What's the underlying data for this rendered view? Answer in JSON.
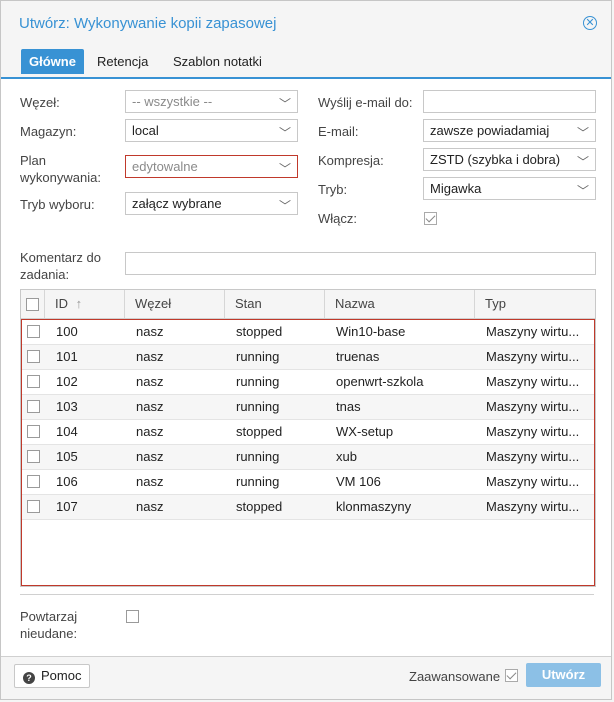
{
  "window": {
    "title": "Utwórz: Wykonywanie kopii zapasowej",
    "close_icon": "close-circle-icon"
  },
  "tabs": [
    {
      "label": "Główne",
      "active": true
    },
    {
      "label": "Retencja",
      "active": false
    },
    {
      "label": "Szablon notatki",
      "active": false
    }
  ],
  "form_left": {
    "node": {
      "label": "Węzeł:",
      "value": "-- wszystkie --"
    },
    "storage": {
      "label": "Magazyn:",
      "value": "local"
    },
    "schedule": {
      "label": "Plan wykonywania:",
      "value": "edytowalne"
    },
    "selection_mode": {
      "label": "Tryb wyboru:",
      "value": "załącz wybrane"
    }
  },
  "form_right": {
    "send_email": {
      "label": "Wyślij e-mail do:",
      "value": ""
    },
    "email": {
      "label": "E-mail:",
      "value": "zawsze powiadamiaj"
    },
    "compression": {
      "label": "Kompresja:",
      "value": "ZSTD (szybka i dobra)"
    },
    "mode": {
      "label": "Tryb:",
      "value": "Migawka"
    },
    "enable": {
      "label": "Włącz:",
      "checked": true
    }
  },
  "comment": {
    "label": "Komentarz do zadania:",
    "value": ""
  },
  "grid": {
    "columns": [
      "ID",
      "Węzeł",
      "Stan",
      "Nazwa",
      "Typ"
    ],
    "sort_icon": "arrow-up-icon",
    "rows": [
      {
        "id": "100",
        "node": "nasz",
        "status": "stopped",
        "name": "Win10-base",
        "type": "Maszyny wirtu..."
      },
      {
        "id": "101",
        "node": "nasz",
        "status": "running",
        "name": "truenas",
        "type": "Maszyny wirtu..."
      },
      {
        "id": "102",
        "node": "nasz",
        "status": "running",
        "name": "openwrt-szkola",
        "type": "Maszyny wirtu..."
      },
      {
        "id": "103",
        "node": "nasz",
        "status": "running",
        "name": "tnas",
        "type": "Maszyny wirtu..."
      },
      {
        "id": "104",
        "node": "nasz",
        "status": "stopped",
        "name": "WX-setup",
        "type": "Maszyny wirtu..."
      },
      {
        "id": "105",
        "node": "nasz",
        "status": "running",
        "name": "xub",
        "type": "Maszyny wirtu..."
      },
      {
        "id": "106",
        "node": "nasz",
        "status": "running",
        "name": "VM 106",
        "type": "Maszyny wirtu..."
      },
      {
        "id": "107",
        "node": "nasz",
        "status": "stopped",
        "name": "klonmaszyny",
        "type": "Maszyny wirtu..."
      }
    ]
  },
  "repeat_missed": {
    "label": "Powtarzaj nieudane:",
    "checked": false
  },
  "footer": {
    "help_label": "Pomoc",
    "help_icon": "question-circle-icon",
    "advanced_label": "Zaawansowane",
    "advanced_checked": true,
    "create_label": "Utwórz"
  }
}
